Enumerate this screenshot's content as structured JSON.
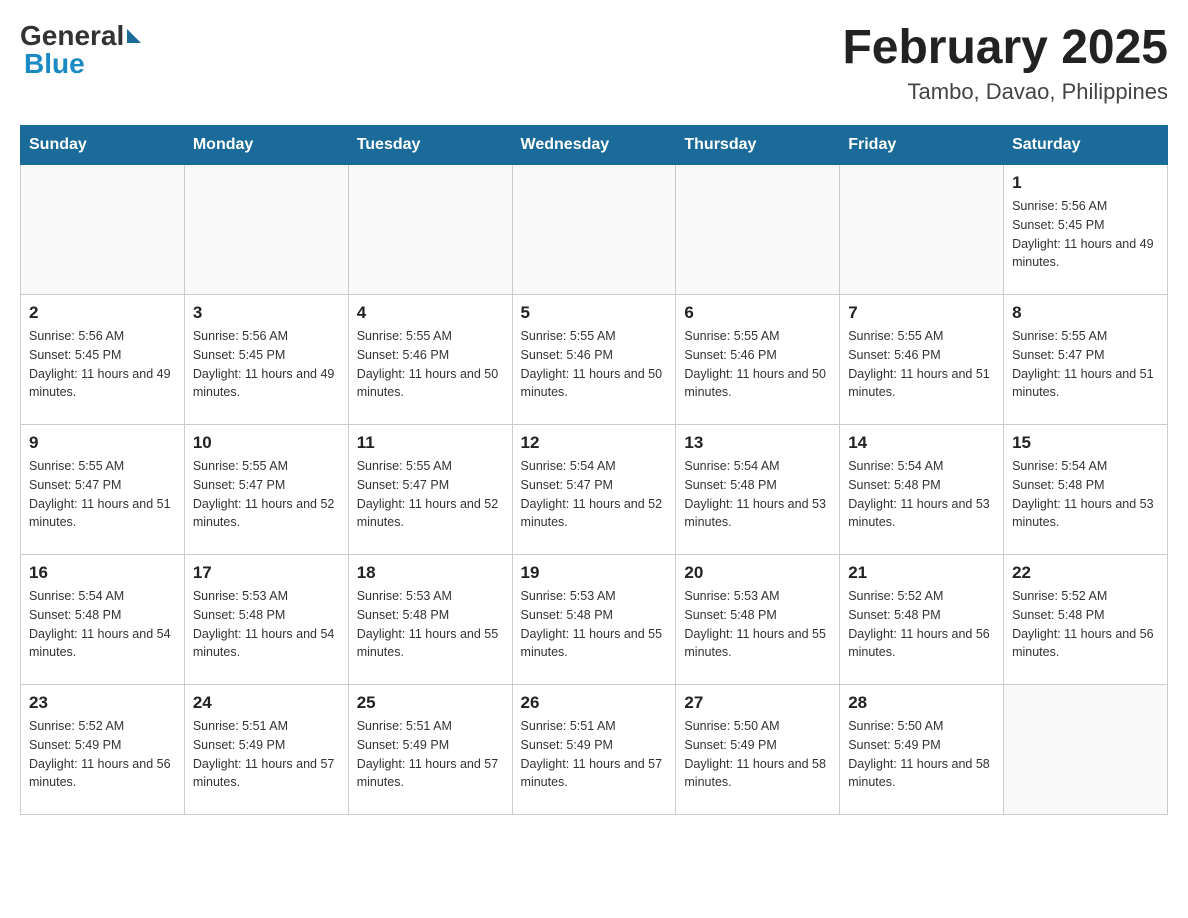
{
  "header": {
    "logo_general": "General",
    "logo_blue": "Blue",
    "month": "February 2025",
    "location": "Tambo, Davao, Philippines"
  },
  "days_of_week": [
    "Sunday",
    "Monday",
    "Tuesday",
    "Wednesday",
    "Thursday",
    "Friday",
    "Saturday"
  ],
  "weeks": [
    [
      {
        "day": "",
        "sunrise": "",
        "sunset": "",
        "daylight": ""
      },
      {
        "day": "",
        "sunrise": "",
        "sunset": "",
        "daylight": ""
      },
      {
        "day": "",
        "sunrise": "",
        "sunset": "",
        "daylight": ""
      },
      {
        "day": "",
        "sunrise": "",
        "sunset": "",
        "daylight": ""
      },
      {
        "day": "",
        "sunrise": "",
        "sunset": "",
        "daylight": ""
      },
      {
        "day": "",
        "sunrise": "",
        "sunset": "",
        "daylight": ""
      },
      {
        "day": "1",
        "sunrise": "Sunrise: 5:56 AM",
        "sunset": "Sunset: 5:45 PM",
        "daylight": "Daylight: 11 hours and 49 minutes."
      }
    ],
    [
      {
        "day": "2",
        "sunrise": "Sunrise: 5:56 AM",
        "sunset": "Sunset: 5:45 PM",
        "daylight": "Daylight: 11 hours and 49 minutes."
      },
      {
        "day": "3",
        "sunrise": "Sunrise: 5:56 AM",
        "sunset": "Sunset: 5:45 PM",
        "daylight": "Daylight: 11 hours and 49 minutes."
      },
      {
        "day": "4",
        "sunrise": "Sunrise: 5:55 AM",
        "sunset": "Sunset: 5:46 PM",
        "daylight": "Daylight: 11 hours and 50 minutes."
      },
      {
        "day": "5",
        "sunrise": "Sunrise: 5:55 AM",
        "sunset": "Sunset: 5:46 PM",
        "daylight": "Daylight: 11 hours and 50 minutes."
      },
      {
        "day": "6",
        "sunrise": "Sunrise: 5:55 AM",
        "sunset": "Sunset: 5:46 PM",
        "daylight": "Daylight: 11 hours and 50 minutes."
      },
      {
        "day": "7",
        "sunrise": "Sunrise: 5:55 AM",
        "sunset": "Sunset: 5:46 PM",
        "daylight": "Daylight: 11 hours and 51 minutes."
      },
      {
        "day": "8",
        "sunrise": "Sunrise: 5:55 AM",
        "sunset": "Sunset: 5:47 PM",
        "daylight": "Daylight: 11 hours and 51 minutes."
      }
    ],
    [
      {
        "day": "9",
        "sunrise": "Sunrise: 5:55 AM",
        "sunset": "Sunset: 5:47 PM",
        "daylight": "Daylight: 11 hours and 51 minutes."
      },
      {
        "day": "10",
        "sunrise": "Sunrise: 5:55 AM",
        "sunset": "Sunset: 5:47 PM",
        "daylight": "Daylight: 11 hours and 52 minutes."
      },
      {
        "day": "11",
        "sunrise": "Sunrise: 5:55 AM",
        "sunset": "Sunset: 5:47 PM",
        "daylight": "Daylight: 11 hours and 52 minutes."
      },
      {
        "day": "12",
        "sunrise": "Sunrise: 5:54 AM",
        "sunset": "Sunset: 5:47 PM",
        "daylight": "Daylight: 11 hours and 52 minutes."
      },
      {
        "day": "13",
        "sunrise": "Sunrise: 5:54 AM",
        "sunset": "Sunset: 5:48 PM",
        "daylight": "Daylight: 11 hours and 53 minutes."
      },
      {
        "day": "14",
        "sunrise": "Sunrise: 5:54 AM",
        "sunset": "Sunset: 5:48 PM",
        "daylight": "Daylight: 11 hours and 53 minutes."
      },
      {
        "day": "15",
        "sunrise": "Sunrise: 5:54 AM",
        "sunset": "Sunset: 5:48 PM",
        "daylight": "Daylight: 11 hours and 53 minutes."
      }
    ],
    [
      {
        "day": "16",
        "sunrise": "Sunrise: 5:54 AM",
        "sunset": "Sunset: 5:48 PM",
        "daylight": "Daylight: 11 hours and 54 minutes."
      },
      {
        "day": "17",
        "sunrise": "Sunrise: 5:53 AM",
        "sunset": "Sunset: 5:48 PM",
        "daylight": "Daylight: 11 hours and 54 minutes."
      },
      {
        "day": "18",
        "sunrise": "Sunrise: 5:53 AM",
        "sunset": "Sunset: 5:48 PM",
        "daylight": "Daylight: 11 hours and 55 minutes."
      },
      {
        "day": "19",
        "sunrise": "Sunrise: 5:53 AM",
        "sunset": "Sunset: 5:48 PM",
        "daylight": "Daylight: 11 hours and 55 minutes."
      },
      {
        "day": "20",
        "sunrise": "Sunrise: 5:53 AM",
        "sunset": "Sunset: 5:48 PM",
        "daylight": "Daylight: 11 hours and 55 minutes."
      },
      {
        "day": "21",
        "sunrise": "Sunrise: 5:52 AM",
        "sunset": "Sunset: 5:48 PM",
        "daylight": "Daylight: 11 hours and 56 minutes."
      },
      {
        "day": "22",
        "sunrise": "Sunrise: 5:52 AM",
        "sunset": "Sunset: 5:48 PM",
        "daylight": "Daylight: 11 hours and 56 minutes."
      }
    ],
    [
      {
        "day": "23",
        "sunrise": "Sunrise: 5:52 AM",
        "sunset": "Sunset: 5:49 PM",
        "daylight": "Daylight: 11 hours and 56 minutes."
      },
      {
        "day": "24",
        "sunrise": "Sunrise: 5:51 AM",
        "sunset": "Sunset: 5:49 PM",
        "daylight": "Daylight: 11 hours and 57 minutes."
      },
      {
        "day": "25",
        "sunrise": "Sunrise: 5:51 AM",
        "sunset": "Sunset: 5:49 PM",
        "daylight": "Daylight: 11 hours and 57 minutes."
      },
      {
        "day": "26",
        "sunrise": "Sunrise: 5:51 AM",
        "sunset": "Sunset: 5:49 PM",
        "daylight": "Daylight: 11 hours and 57 minutes."
      },
      {
        "day": "27",
        "sunrise": "Sunrise: 5:50 AM",
        "sunset": "Sunset: 5:49 PM",
        "daylight": "Daylight: 11 hours and 58 minutes."
      },
      {
        "day": "28",
        "sunrise": "Sunrise: 5:50 AM",
        "sunset": "Sunset: 5:49 PM",
        "daylight": "Daylight: 11 hours and 58 minutes."
      },
      {
        "day": "",
        "sunrise": "",
        "sunset": "",
        "daylight": ""
      }
    ]
  ]
}
